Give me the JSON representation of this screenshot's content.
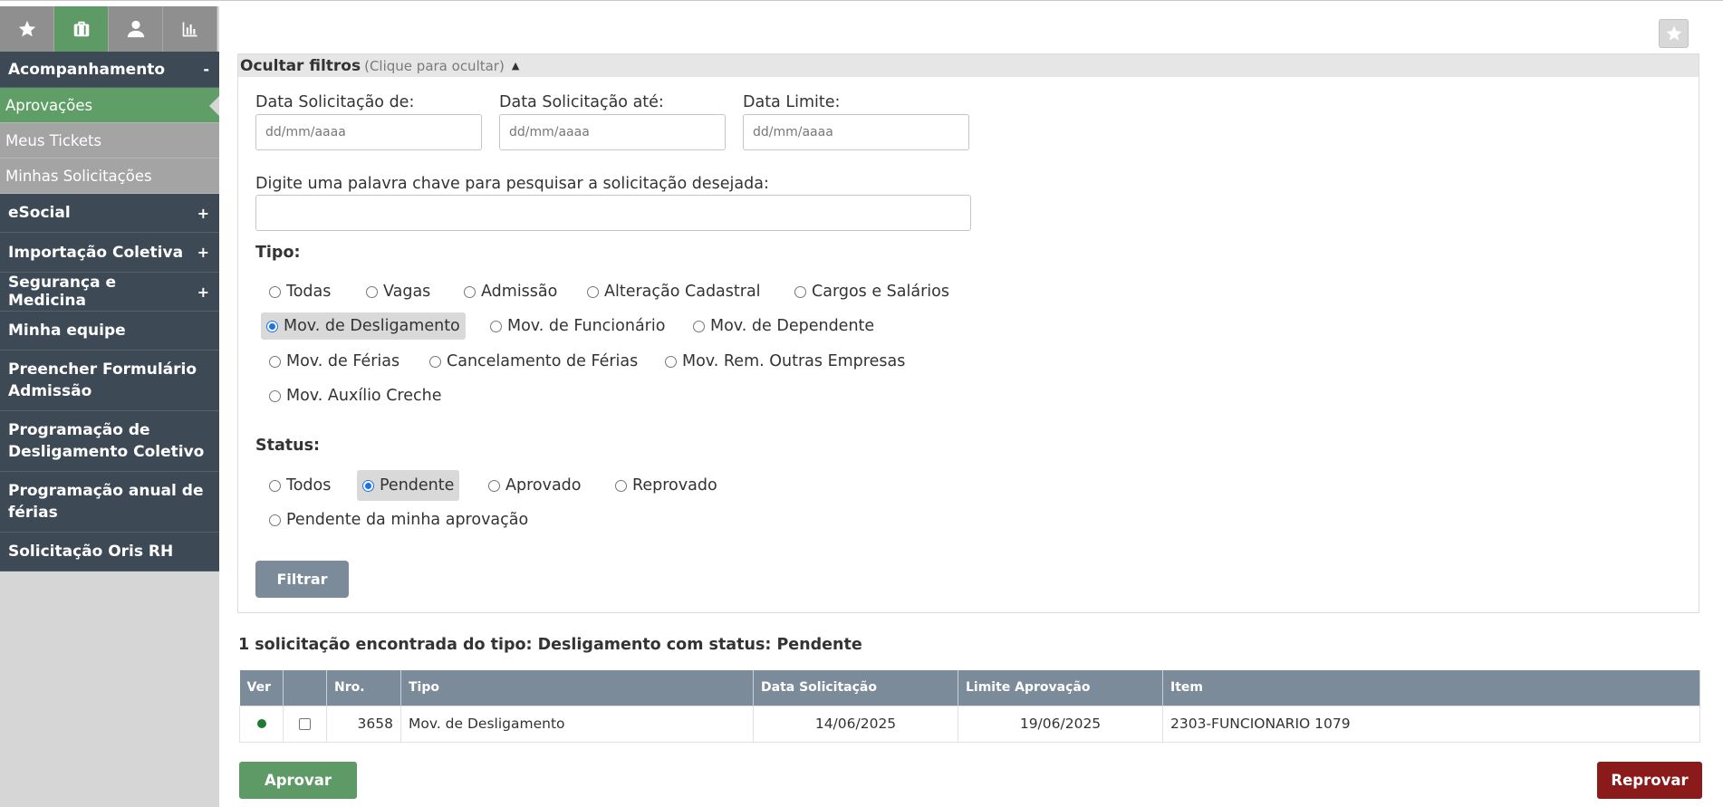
{
  "icon_tabs": [
    {
      "icon": "star-icon",
      "active": false
    },
    {
      "icon": "briefcase-icon",
      "active": true
    },
    {
      "icon": "user-icon",
      "active": false
    },
    {
      "icon": "bar-chart-icon",
      "active": false
    }
  ],
  "sidebar": {
    "acompanhamento": {
      "label": "Acompanhamento",
      "toggle": "-"
    },
    "submenu": [
      {
        "label": "Aprovações"
      },
      {
        "label": "Meus Tickets"
      },
      {
        "label": "Minhas Solicitações"
      }
    ],
    "esocial": {
      "label": "eSocial",
      "toggle": "+"
    },
    "importacao": {
      "label": "Importação Coletiva",
      "toggle": "+"
    },
    "seguranca": {
      "label": "Segurança e Medicina",
      "toggle": "+"
    },
    "minha_equipe": {
      "label": "Minha equipe"
    },
    "preencher": {
      "label": "Preencher Formulário Admissão"
    },
    "programacao_desligamento": {
      "label": "Programação de Desligamento Coletivo"
    },
    "programacao_ferias": {
      "label": "Programação anual de férias"
    },
    "solicitacao_oris": {
      "label": "Solicitação Oris RH"
    }
  },
  "filters": {
    "title": "Ocultar filtros",
    "hint": "(Clique para ocultar)",
    "arrow": "▲",
    "date_from_label": "Data Solicitação de:",
    "date_to_label": "Data Solicitação até:",
    "date_limit_label": "Data Limite:",
    "date_placeholder": "dd/mm/aaaa",
    "keyword_label": "Digite uma palavra chave para pesquisar a solicitação desejada:",
    "tipo_label": "Tipo:",
    "tipo_options": [
      {
        "label": "Todas"
      },
      {
        "label": "Vagas"
      },
      {
        "label": "Admissão"
      },
      {
        "label": "Alteração Cadastral"
      },
      {
        "label": "Cargos e Salários"
      },
      {
        "label": "Mov. de Desligamento"
      },
      {
        "label": "Mov. de Funcionário"
      },
      {
        "label": "Mov. de Dependente"
      },
      {
        "label": "Mov. de Férias"
      },
      {
        "label": "Cancelamento de Férias"
      },
      {
        "label": "Mov. Rem. Outras Empresas"
      },
      {
        "label": "Mov. Auxílio Creche"
      }
    ],
    "tipo_selected": "Mov. de Desligamento",
    "status_label": "Status:",
    "status_options": [
      {
        "label": "Todos"
      },
      {
        "label": "Pendente"
      },
      {
        "label": "Aprovado"
      },
      {
        "label": "Reprovado"
      },
      {
        "label": "Pendente da minha aprovação"
      }
    ],
    "status_selected": "Pendente",
    "filter_button": "Filtrar"
  },
  "results": {
    "summary": "1 solicitação encontrada do tipo: Desligamento com status: Pendente",
    "columns": [
      "Ver",
      "",
      "Nro.",
      "Tipo",
      "Data Solicitação",
      "Limite Aprovação",
      "Item"
    ],
    "rows": [
      {
        "nro": "3658",
        "tipo": "Mov. de Desligamento",
        "data_solicitacao": "14/06/2025",
        "limite_aprovacao": "19/06/2025",
        "item": "2303-FUNCIONARIO 1079",
        "status_color": "#1f7a33"
      }
    ]
  },
  "actions": {
    "approve": "Aprovar",
    "reject": "Reprovar"
  },
  "colors": {
    "accent_green": "#5e9a66",
    "sidebar_dark": "#3d4a56",
    "reject_red": "#8b1a1a",
    "table_header": "#7b8b99"
  }
}
